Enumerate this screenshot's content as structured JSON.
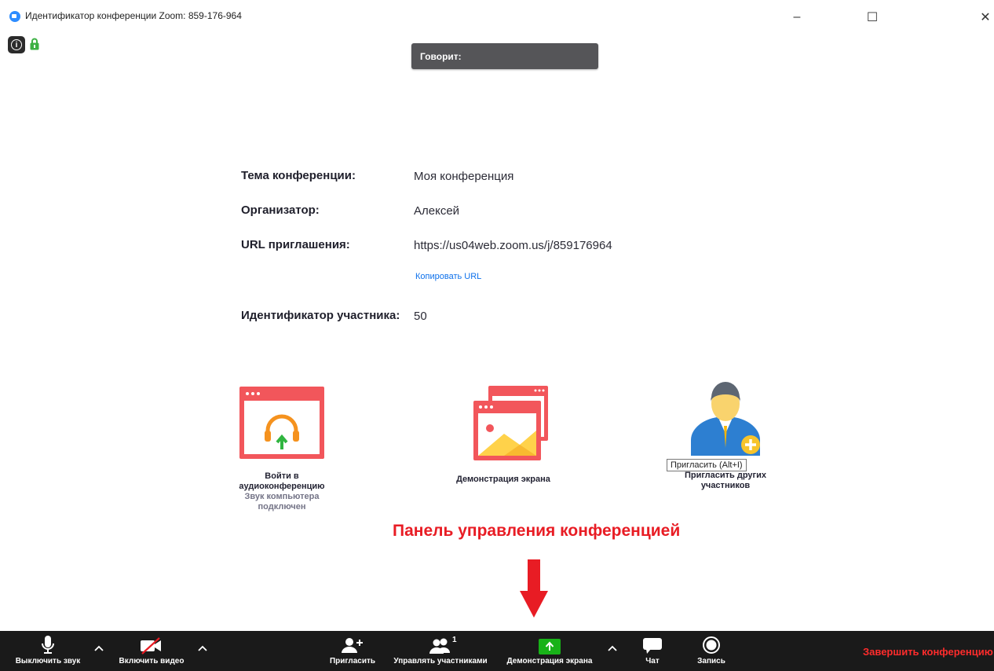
{
  "window": {
    "title": "Идентификатор конференции Zoom: 859-176-964",
    "controls": {
      "minimize": "–",
      "maximize": "☐",
      "close": "✕"
    }
  },
  "speaking": {
    "label": "Говорит:"
  },
  "meeting_info": {
    "topic_label": "Тема конференции:",
    "topic_value": "Моя конференция",
    "host_label": "Организатор:",
    "host_value": "Алексей",
    "url_label": "URL приглашения:",
    "url_value": "https://us04web.zoom.us/j/859176964",
    "copy_url": "Копировать URL",
    "participant_id_label": "Идентификатор участника:",
    "participant_id_value": "50"
  },
  "tiles": {
    "audio": {
      "label_line1": "Войти в",
      "label_line2": "аудиоконференцию",
      "sub_line1": "Звук компьютера",
      "sub_line2": "подключен",
      "icon": "join-audio-icon"
    },
    "share": {
      "label": "Демонстрация экрана",
      "icon": "share-screen-icon"
    },
    "invite": {
      "label_line1": "Пригласить других",
      "label_line2": "участников",
      "icon": "invite-person-icon",
      "tooltip": "Пригласить (Alt+I)"
    }
  },
  "annotation": {
    "text": "Панель управления конференцией"
  },
  "toolbar": {
    "mute": "Выключить звук",
    "video": "Включить видео",
    "invite": "Пригласить",
    "participants": "Управлять участниками",
    "participants_count": "1",
    "share": "Демонстрация экрана",
    "chat": "Чат",
    "record": "Запись",
    "end": "Завершить конференцию"
  },
  "colors": {
    "accent_red": "#e81c24",
    "tile_red": "#f2565b",
    "share_green": "#18b218",
    "toolbar_bg": "#1a1a1a",
    "link_blue": "#0e71eb",
    "invite_blue": "#2d7fd1"
  }
}
